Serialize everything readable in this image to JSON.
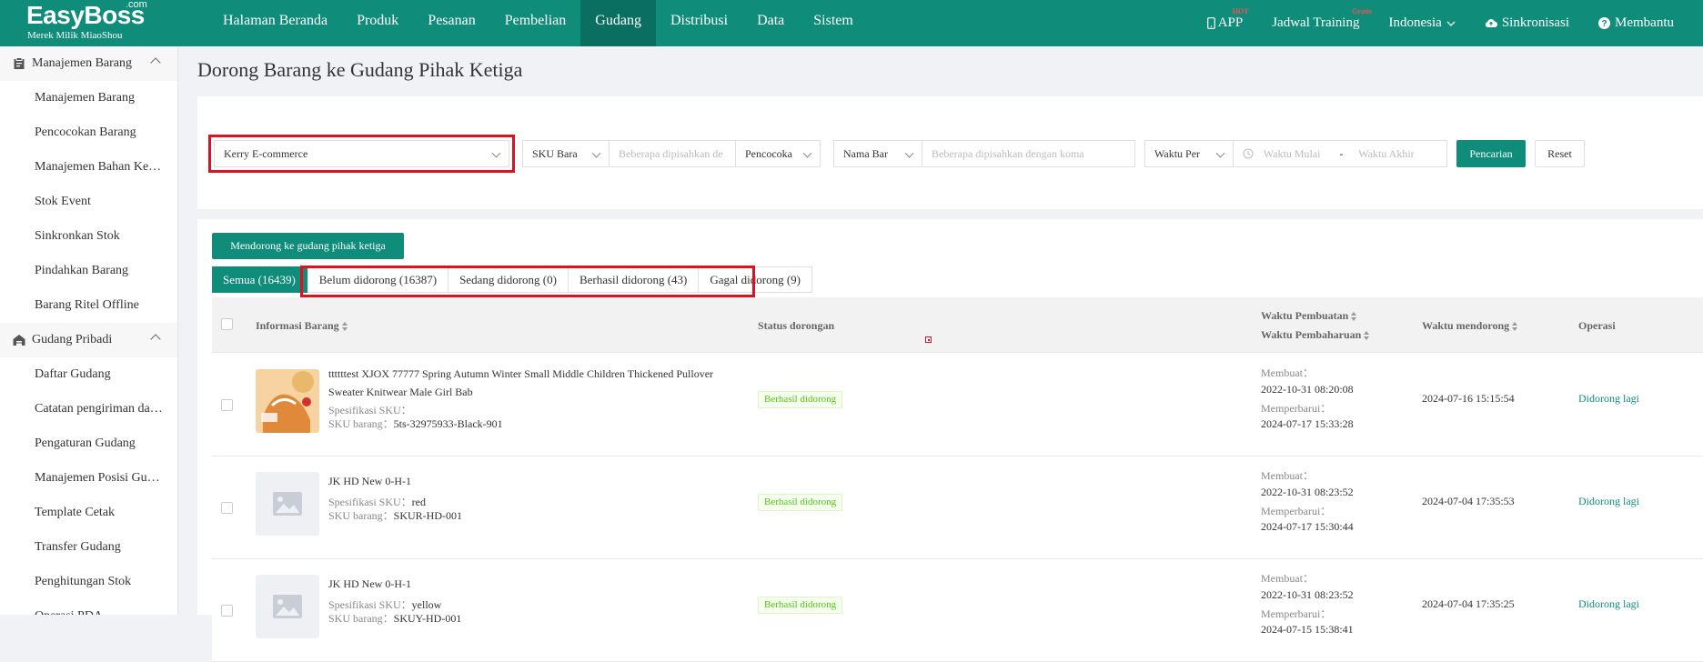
{
  "brand": {
    "name": "EasyBoss",
    "com": ".com",
    "subtitle": "Merek Milik MiaoShou"
  },
  "nav": [
    "Halaman Beranda",
    "Produk",
    "Pesanan",
    "Pembelian",
    "Gudang",
    "Distribusi",
    "Data",
    "Sistem"
  ],
  "topright": {
    "app": "APP",
    "app_badge": "HOT",
    "training": "Jadwal Training",
    "training_badge": "Gratis",
    "language": "Indonesia",
    "sync": "Sinkronisasi",
    "help": "Membantu"
  },
  "sidebar": {
    "group1": "Manajemen Barang",
    "group1_items": [
      "Manajemen Barang",
      "Pencocokan Barang",
      "Manajemen Bahan Ke…",
      "Stok Event",
      "Sinkronkan Stok",
      "Pindahkan Barang",
      "Barang Ritel Offline"
    ],
    "group2": "Gudang Pribadi",
    "group2_items": [
      "Daftar Gudang",
      "Catatan pengiriman da…",
      "Pengaturan Gudang",
      "Manajemen Posisi Gu…",
      "Template Cetak",
      "Transfer Gudang",
      "Penghitungan Stok",
      "Operasi PDA"
    ]
  },
  "page_title": "Dorong Barang ke Gudang Pihak Ketiga",
  "filters": {
    "warehouse": "Kerry E-commerce",
    "sku_type": "SKU Bara",
    "sku_placeholder": "Beberapa dipisahkan de",
    "match": "Pencocoka",
    "name_type": "Nama Bar",
    "name_placeholder": "Beberapa dipisahkan dengan koma",
    "time_type": "Waktu Per",
    "start_placeholder": "Waktu Mulai",
    "dash": "-",
    "end_placeholder": "Waktu Akhir",
    "search": "Pencarian",
    "reset": "Reset"
  },
  "push_button": "Mendorong ke gudang pihak ketiga",
  "tabs": [
    "Semua (16439)",
    "Belum didorong (16387)",
    "Sedang didorong (0)",
    "Berhasil didorong (43)",
    "Gagal didorong (9)"
  ],
  "columns": {
    "info": "Informasi Barang",
    "status": "Status dorongan",
    "created": "Waktu Pembuatan",
    "updated": "Waktu Pembaharuan",
    "pushed": "Waktu mendorong",
    "op": "Operasi"
  },
  "labels": {
    "spec": "Spesifikasi SKU：",
    "sku": "SKU barang：",
    "created": "Membuat：",
    "updated": "Memperbarui："
  },
  "rows": [
    {
      "name": "ttttttest XJOX 77777 Spring Autumn Winter Small Middle Children Thickened Pullover Sweater Knitwear Male Girl Bab",
      "spec": "",
      "sku": "5ts-32975933-Black-901",
      "status": "Berhasil didorong",
      "created": "2022-10-31 08:20:08",
      "updated": "2024-07-17 15:33:28",
      "pushed": "2024-07-16 15:15:54",
      "op": "Didorong lagi"
    },
    {
      "name": "JK HD New 0-H-1",
      "spec": "red",
      "sku": "SKUR-HD-001",
      "status": "Berhasil didorong",
      "created": "2022-10-31 08:23:52",
      "updated": "2024-07-17 15:30:44",
      "pushed": "2024-07-04 17:35:53",
      "op": "Didorong lagi"
    },
    {
      "name": "JK HD New 0-H-1",
      "spec": "yellow",
      "sku": "SKUY-HD-001",
      "status": "Berhasil didorong",
      "created": "2022-10-31 08:23:52",
      "updated": "2024-07-15 15:38:41",
      "pushed": "2024-07-04 17:35:25",
      "op": "Didorong lagi"
    }
  ]
}
